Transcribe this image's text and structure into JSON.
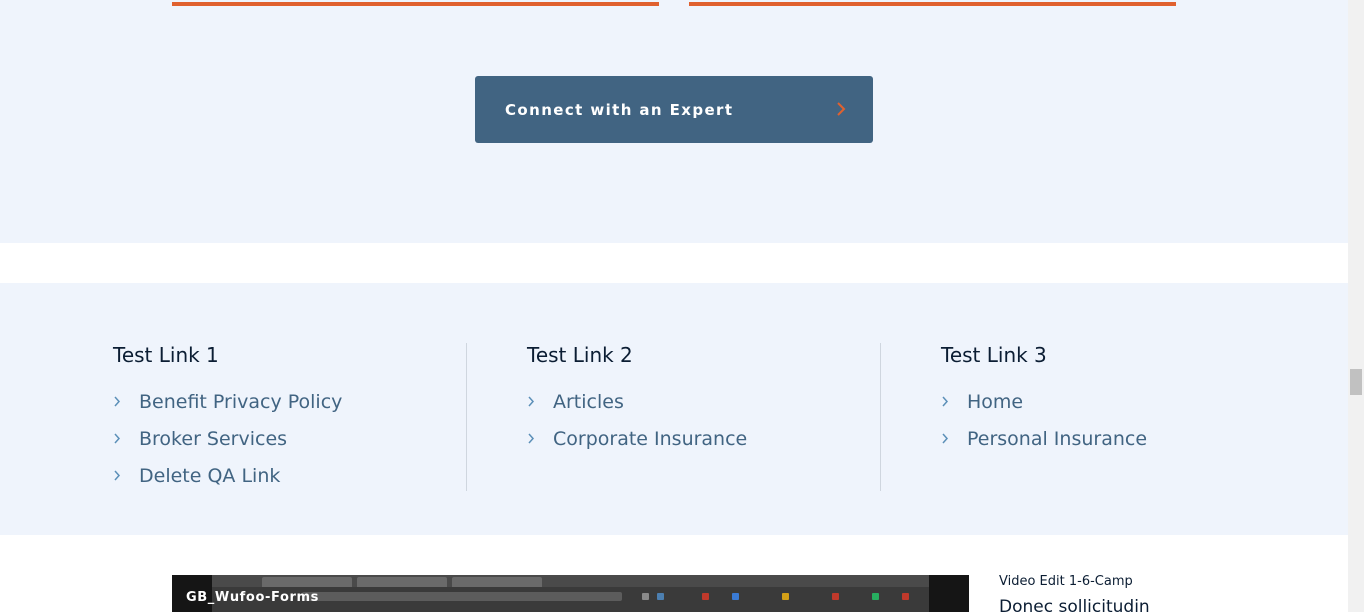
{
  "colors": {
    "accent": "#e0612f",
    "button_bg": "#416482",
    "section_bg": "#eff4fc",
    "link_text": "#416482",
    "heading_text": "#0b1d33"
  },
  "cta": {
    "label": "Connect with an Expert",
    "icon": "chevron-right-icon"
  },
  "link_columns": [
    {
      "title": "Test Link 1",
      "links": [
        "Benefit Privacy Policy",
        "Broker Services",
        "Delete QA Link"
      ]
    },
    {
      "title": "Test Link 2",
      "links": [
        "Articles",
        "Corporate Insurance"
      ]
    },
    {
      "title": "Test Link 3",
      "links": [
        "Home",
        "Personal Insurance"
      ]
    }
  ],
  "media": {
    "video_title": "GB_Wufoo-Forms",
    "caption": "Video Edit 1-6-Camp",
    "headline": "Donec sollicitudin"
  }
}
